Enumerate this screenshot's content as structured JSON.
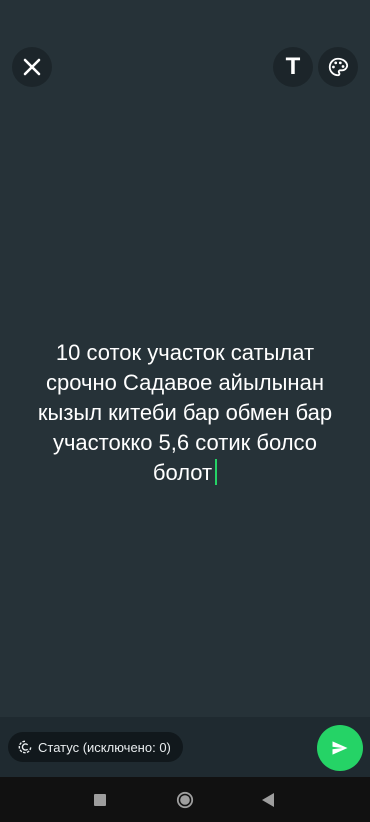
{
  "top_bar": {
    "close_icon": "close-icon",
    "text_tool_label": "T",
    "palette_icon": "palette-icon"
  },
  "status_text": {
    "value": "10 соток участок сатылат срочно Садавое айылынан кызыл китеби бар обмен бар участокко 5,6 сотик болсо болот",
    "color": "#ffffff",
    "caret_color": "#25d366"
  },
  "footer": {
    "privacy_label": "Статус (исключено: 0)",
    "privacy_icon": "status-privacy-icon",
    "send_icon": "send-icon",
    "send_color": "#25d366"
  },
  "navigation": {
    "recents_icon": "square-icon",
    "home_icon": "circle-icon",
    "back_icon": "triangle-back-icon"
  },
  "colors": {
    "background": "#263238",
    "accent": "#25d366"
  }
}
